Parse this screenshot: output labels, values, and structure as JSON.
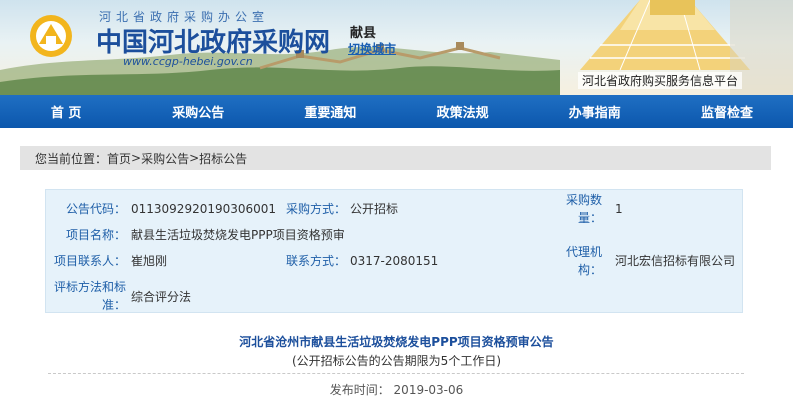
{
  "header": {
    "org_small": "河北省政府采购办公室",
    "org_title": "中国河北政府采购网",
    "url": "www.ccgp-hebei.gov.cn",
    "region": "献县",
    "switch_city": "切换城市",
    "platform": "河北省政府购买服务信息平台"
  },
  "nav": {
    "items": [
      {
        "label": "首 页"
      },
      {
        "label": "采购公告"
      },
      {
        "label": "重要通知"
      },
      {
        "label": "政策法规"
      },
      {
        "label": "办事指南"
      },
      {
        "label": "监督检查"
      }
    ]
  },
  "breadcrumb": {
    "lead": "您当前位置：",
    "home": "首页",
    "sep": ">",
    "section": "采购公告",
    "current": "招标公告"
  },
  "info": {
    "notice_code_label": "公告代码：",
    "notice_code": "0113092920190306001",
    "method_label": "采购方式：",
    "method": "公开招标",
    "qty_label_1": "采购数",
    "qty_label_2": "量：",
    "qty": "1",
    "project_label": "项目名称：",
    "project": "献县生活垃圾焚烧发电PPP项目资格预审",
    "contact_label": "项目联系人：",
    "contact": "崔旭刚",
    "phone_label": "联系方式：",
    "phone": "0317-2080151",
    "agency_label_1": "代理机",
    "agency_label_2": "构：",
    "agency": "河北宏信招标有限公司",
    "eval_label_1": "评标方法和标",
    "eval_label_2": "准：",
    "eval": "综合评分法"
  },
  "notice": {
    "title": "河北省沧州市献县生活垃圾焚烧发电PPP项目资格预审公告",
    "subtitle": "(公开招标公告的公告期限为5个工作日)",
    "publish_label": "发布时间：",
    "publish_date": "2019-03-06"
  },
  "colors": {
    "nav_blue": "#0c57ad",
    "brand_blue": "#1c4f9c",
    "info_bg": "#e6f2fa",
    "crumb_bg": "#e3e3e3"
  }
}
